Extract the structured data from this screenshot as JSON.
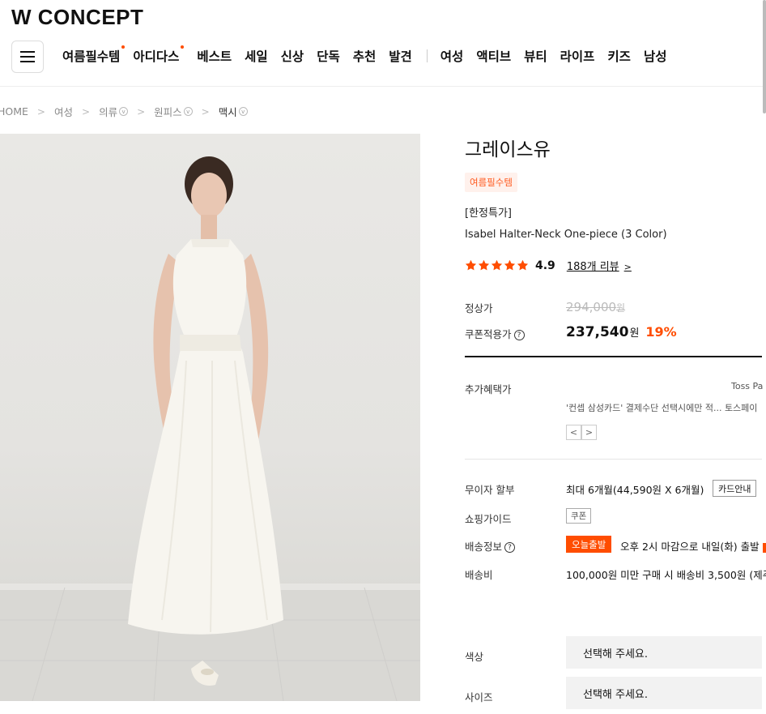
{
  "header": {
    "logo": "W CONCEPT",
    "nav_primary": [
      {
        "label": "여름필수템",
        "dot": true
      },
      {
        "label": "아디다스",
        "dot": true
      },
      {
        "label": "베스트",
        "dot": false
      },
      {
        "label": "세일",
        "dot": false
      },
      {
        "label": "신상",
        "dot": false
      },
      {
        "label": "단독",
        "dot": false
      },
      {
        "label": "추천",
        "dot": false
      },
      {
        "label": "발견",
        "dot": false
      }
    ],
    "nav_secondary": [
      "여성",
      "액티브",
      "뷰티",
      "라이프",
      "키즈",
      "남성"
    ]
  },
  "breadcrumb": [
    {
      "label": "HOME",
      "dropdown": false
    },
    {
      "label": "여성",
      "dropdown": false
    },
    {
      "label": "의류",
      "dropdown": true
    },
    {
      "label": "원피스",
      "dropdown": true
    },
    {
      "label": "맥시",
      "dropdown": true
    }
  ],
  "product": {
    "brand": "그레이스유",
    "tag": "여름필수템",
    "promo": "[한정특가]",
    "name": "Isabel Halter-Neck One-piece (3 Color)",
    "rating": "4.9",
    "stars": 5,
    "reviews": "188개 리뷰"
  },
  "pricing": {
    "regular_label": "정상가",
    "regular_price": "294,000",
    "regular_unit": "원",
    "coupon_label": "쿠폰적용가",
    "coupon_price": "237,540",
    "coupon_unit": "원",
    "discount": "19%"
  },
  "benefits": {
    "label": "추가혜택가",
    "right_text": "Toss Pa",
    "desc": "'컨셉 삼성카드' 결제수단 선택시에만 적... 토스페이",
    "prev": "<",
    "next": ">"
  },
  "details": {
    "installment_label": "무이자 할부",
    "installment_value": "최대 6개월(44,590원 X 6개월)",
    "card_info_button": "카드안내",
    "guide_label": "쇼핑가이드",
    "guide_badge": "쿠폰",
    "shipping_label": "배송정보",
    "shipping_badge": "오늘출발",
    "shipping_text": "오후 2시 마감으로 내일(화) 출발",
    "fee_label": "배송비",
    "fee_text": "100,000원 미만 구매 시 배송비 3,500원 (제주"
  },
  "options": {
    "color_label": "색상",
    "color_placeholder": "선택해 주세요.",
    "size_label": "사이즈",
    "size_placeholder": "선택해 주세요."
  },
  "colors": {
    "accent": "#ff4d00",
    "tag_bg": "#fff1ec"
  }
}
